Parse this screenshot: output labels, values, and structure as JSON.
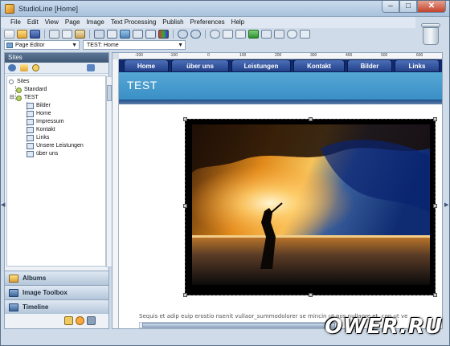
{
  "window": {
    "title": "StudioLine [Home]"
  },
  "menu": [
    "File",
    "Edit",
    "View",
    "Page",
    "Image",
    "Text Processing",
    "Publish",
    "Preferences",
    "Help"
  ],
  "subbar": {
    "editor_mode": "Page Editor",
    "page_path": "TEST: Home"
  },
  "left_panel": {
    "title": "Sites",
    "tree": {
      "root": "Sites",
      "sites": [
        {
          "name": "Standard"
        },
        {
          "name": "TEST",
          "pages": [
            "Bilder",
            "Home",
            "Impressum",
            "Kontakt",
            "Links",
            "Unsere Leistungen",
            "über uns"
          ]
        }
      ]
    },
    "accordion": [
      "Albums",
      "Image Toolbox",
      "Timeline"
    ]
  },
  "ruler": {
    "top_labels": [
      "-200",
      "-100",
      "0",
      "100",
      "200",
      "300",
      "400",
      "500",
      "600"
    ]
  },
  "page": {
    "nav_tabs": [
      "Home",
      "über uns",
      "Leistungen",
      "Kontakt",
      "Bilder",
      "Links"
    ],
    "header_title": "TEST",
    "body_text": "Sequis et adip euip erostio nsenit vullaor_summodolorer se mincin ut nos nullaore et, con ut ve"
  },
  "watermark": "OWER.RU",
  "colors": {
    "nav_bg": "#102a6e",
    "header_band": "#4a9fd0",
    "panel_title": "#4d6685"
  }
}
